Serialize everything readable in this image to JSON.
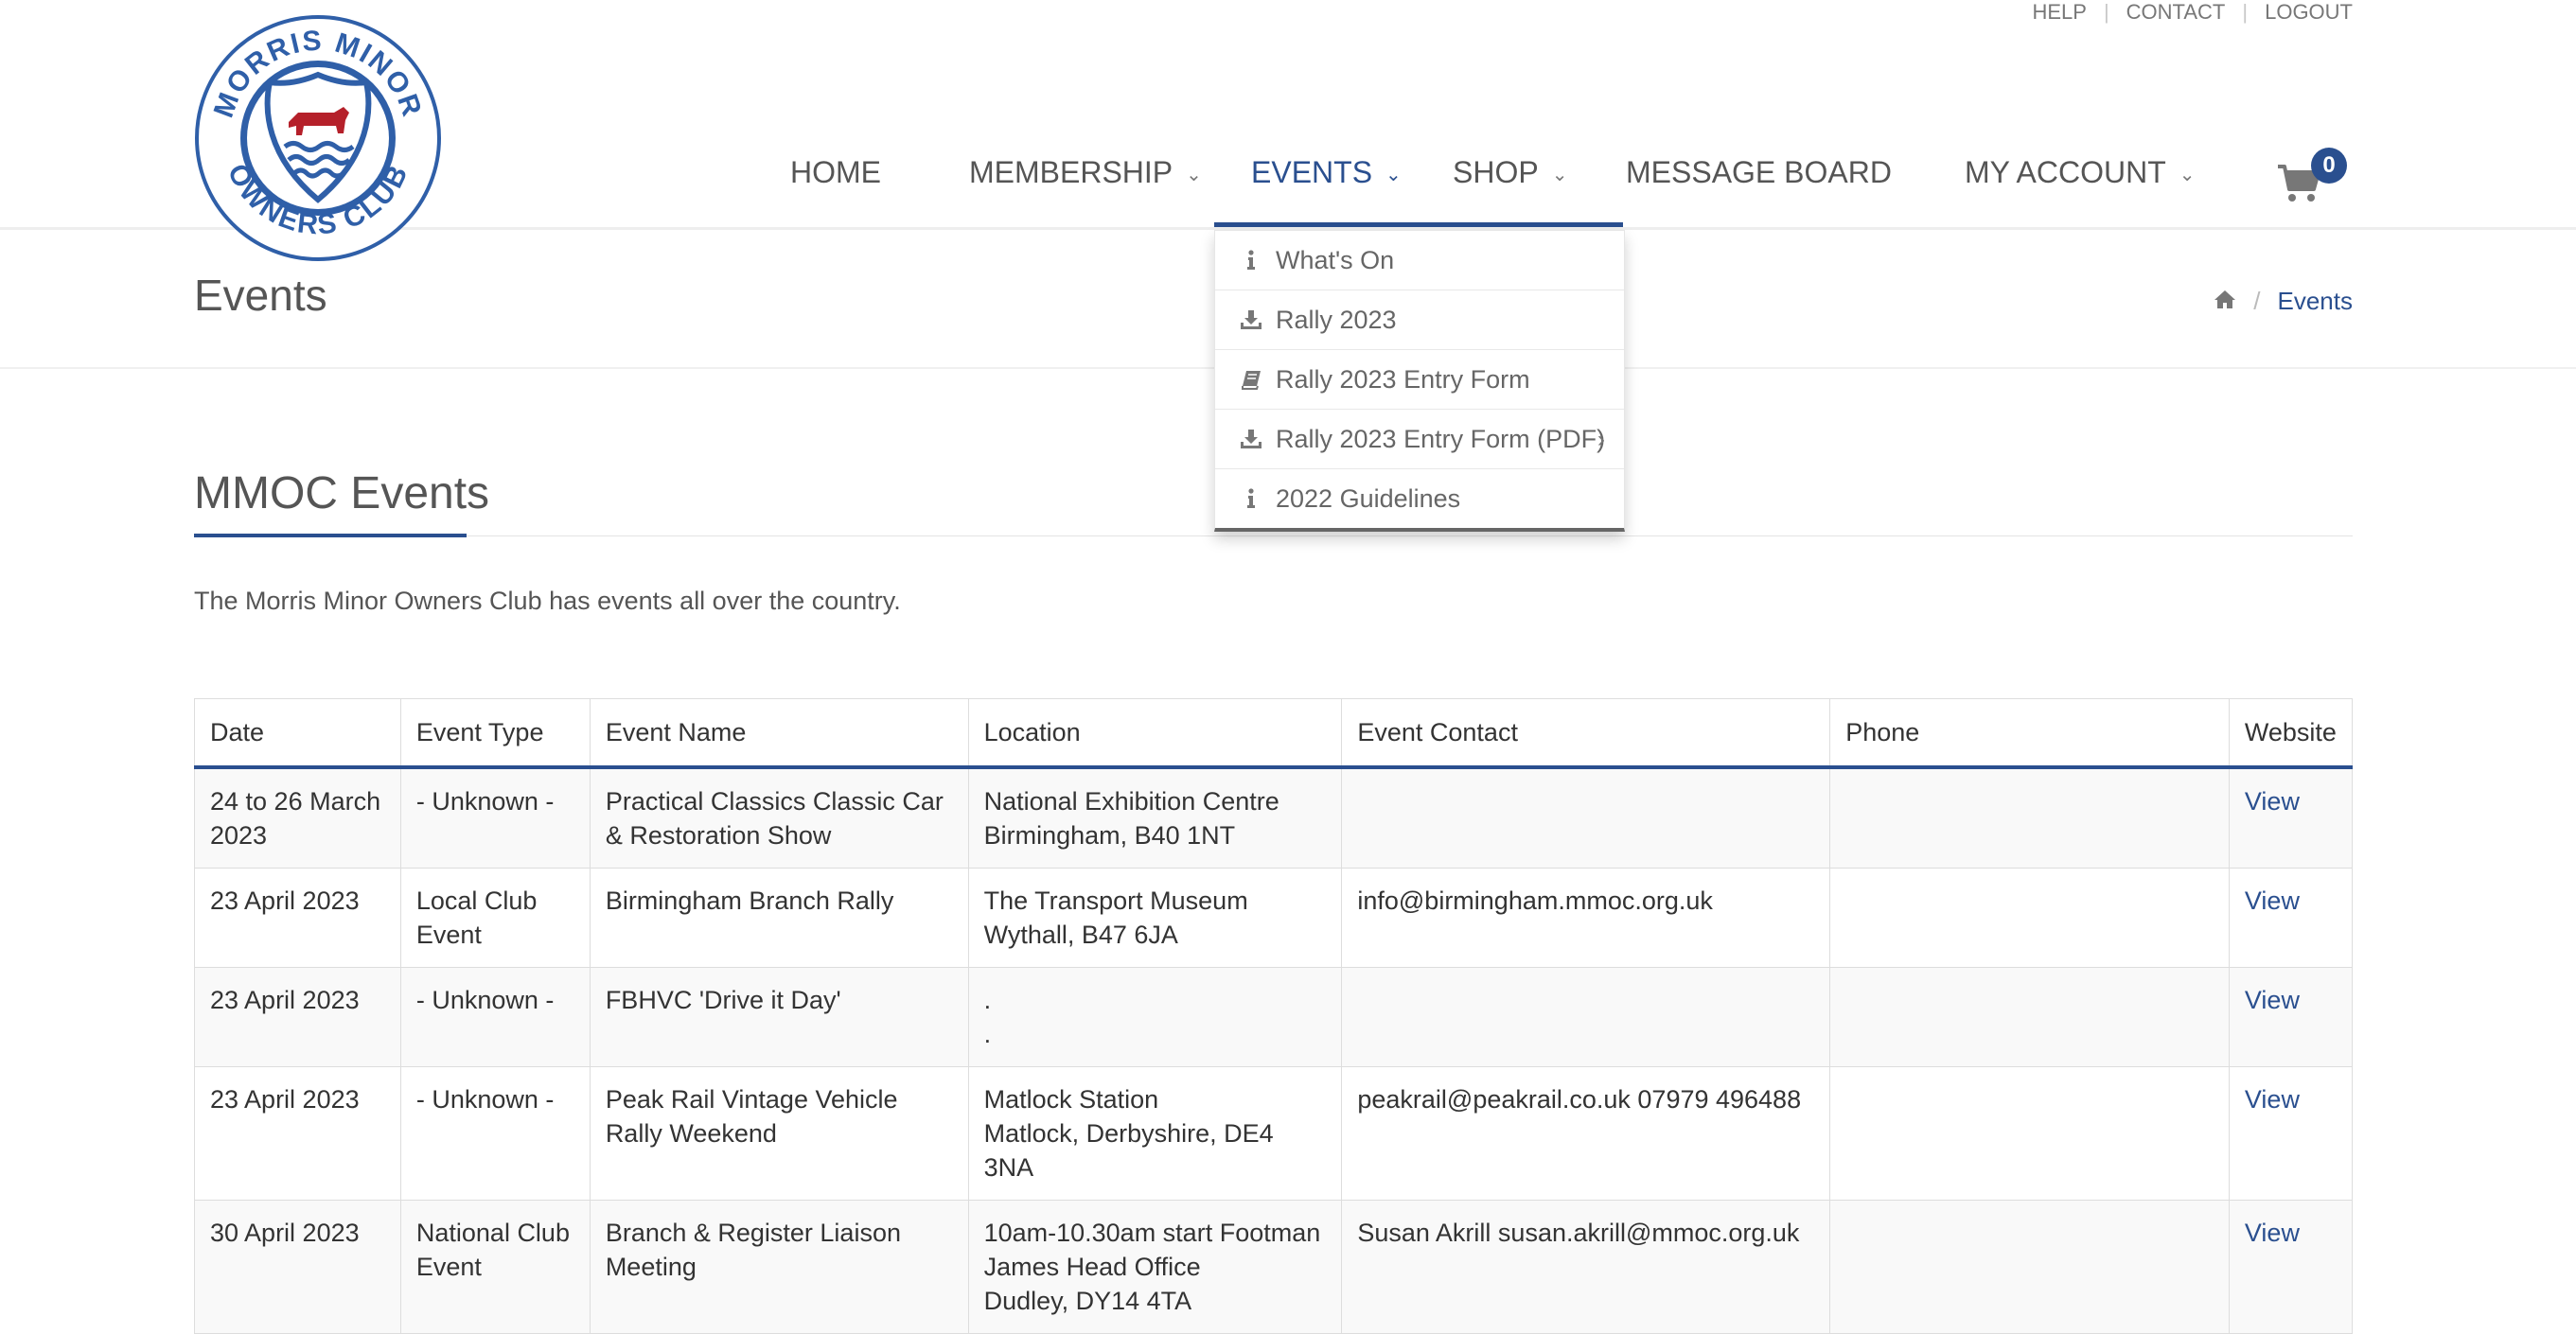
{
  "top_links": [
    "HELP",
    "CONTACT",
    "LOGOUT"
  ],
  "logo": {
    "text": "MORRIS MINOR OWNERS CLUB"
  },
  "nav": {
    "home": "HOME",
    "membership": "MEMBERSHIP",
    "events": "EVENTS",
    "shop": "SHOP",
    "message_board": "MESSAGE BOARD",
    "my_account": "MY ACCOUNT",
    "active": "EVENTS"
  },
  "cart": {
    "count": "0",
    "icon": "shopping-cart-icon"
  },
  "dropdown": {
    "items": [
      {
        "label": "What's On",
        "icon": "info-icon"
      },
      {
        "label": "Rally 2023",
        "icon": "download-icon"
      },
      {
        "label": "Rally 2023 Entry Form",
        "icon": "book-icon"
      },
      {
        "label": "Rally 2023 Entry Form (PDF)",
        "icon": "download-icon",
        "has_submenu": true
      },
      {
        "label": "2022 Guidelines",
        "icon": "info-icon"
      }
    ]
  },
  "page": {
    "title": "Events",
    "breadcrumb": {
      "home_icon": "home-icon",
      "current": "Events"
    }
  },
  "section": {
    "title": "MMOC Events",
    "intro": "The Morris Minor Owners Club has events all over the country."
  },
  "table": {
    "headers": [
      "Date",
      "Event Type",
      "Event Name",
      "Location",
      "Event Contact",
      "Phone",
      "Website"
    ],
    "rows": [
      {
        "date": "24 to 26 March 2023",
        "type": "- Unknown -",
        "name": "Practical Classics Classic Car & Restoration Show",
        "location": "National Exhibition Centre\nBirmingham, B40 1NT",
        "contact": "",
        "phone": "",
        "website": "View"
      },
      {
        "date": "23 April 2023",
        "type": "Local Club Event",
        "name": "Birmingham Branch Rally",
        "location": "The Transport Museum\nWythall, B47 6JA",
        "contact": "info@birmingham.mmoc.org.uk",
        "phone": "",
        "website": "View"
      },
      {
        "date": "23 April 2023",
        "type": "- Unknown -",
        "name": "FBHVC 'Drive it Day'",
        "location": ".\n.",
        "contact": "",
        "phone": "",
        "website": "View"
      },
      {
        "date": "23 April 2023",
        "type": "- Unknown -",
        "name": "Peak Rail Vintage Vehicle Rally Weekend",
        "location": "Matlock Station\nMatlock, Derbyshire, DE4 3NA",
        "contact": "peakrail@peakrail.co.uk 07979 496488",
        "phone": "",
        "website": "View"
      },
      {
        "date": "30 April 2023",
        "type": "National Club Event",
        "name": "Branch & Register Liaison Meeting",
        "location": "10am-10.30am start Footman James Head Office\nDudley, DY14 4TA",
        "contact": "Susan Akrill susan.akrill@mmoc.org.uk",
        "phone": "",
        "website": "View"
      }
    ]
  },
  "colors": {
    "accent": "#2a4f8f",
    "text": "#333333",
    "muted": "#777777"
  }
}
